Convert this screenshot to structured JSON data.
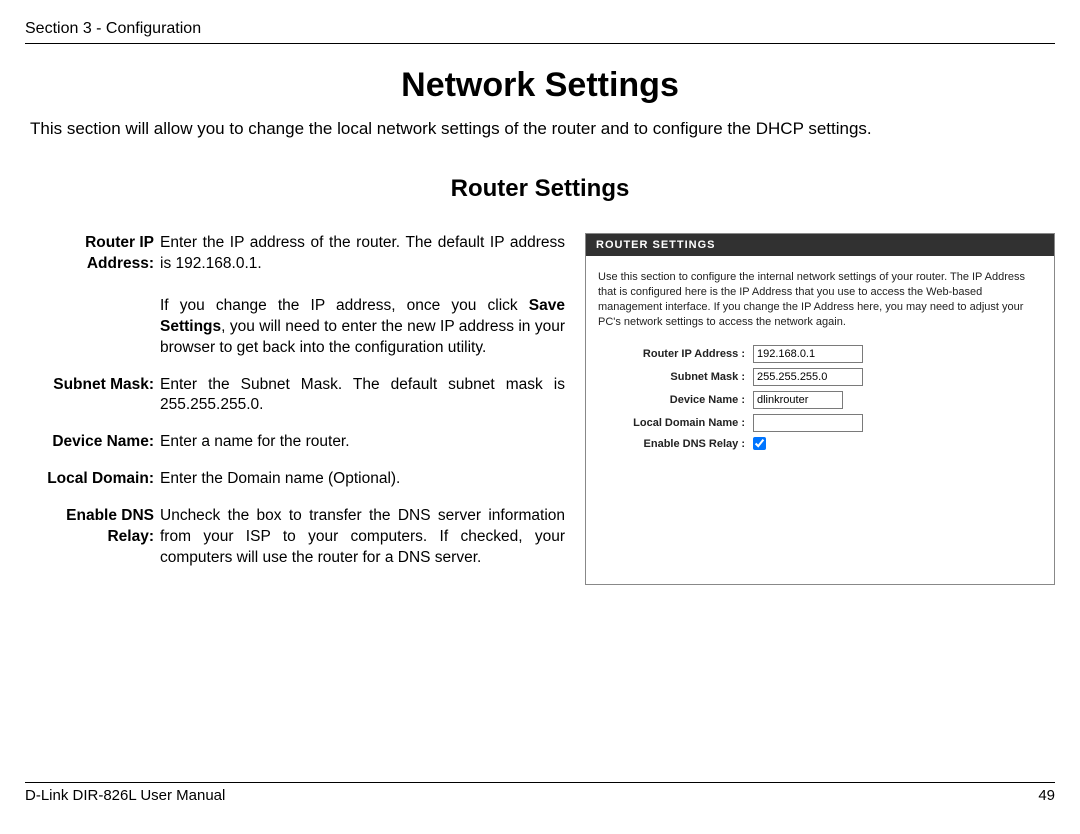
{
  "header": {
    "section_label": "Section 3 - Configuration"
  },
  "title": "Network Settings",
  "intro": "This section will allow you to change the local network settings of the router and to configure the DHCP settings.",
  "subtitle": "Router Settings",
  "definitions": {
    "router_ip": {
      "term": "Router IP Address:",
      "desc1": "Enter the IP address of the router. The default IP address is 192.168.0.1.",
      "desc2a": "If you change the IP address, once you click ",
      "desc2bold": "Save Settings",
      "desc2b": ", you will need to enter the new IP address in your browser to get back into the configuration utility."
    },
    "subnet": {
      "term": "Subnet Mask:",
      "desc": "Enter the Subnet Mask. The default subnet mask is 255.255.255.0."
    },
    "device_name": {
      "term": "Device Name:",
      "desc": "Enter a name for the router."
    },
    "local_domain": {
      "term": "Local Domain:",
      "desc": "Enter the Domain name (Optional)."
    },
    "dns_relay": {
      "term": "Enable DNS Relay:",
      "desc": "Uncheck the box to transfer the DNS server information from your ISP to your computers. If checked, your computers will use the router for a DNS server."
    }
  },
  "panel": {
    "header": "ROUTER SETTINGS",
    "desc": "Use this section to configure the internal network settings of your router. The IP Address that is configured here is the IP Address that you use to access the Web-based management interface. If you change the IP Address here, you may need to adjust your PC's network settings to access the network again.",
    "fields": {
      "router_ip": {
        "label": "Router IP Address :",
        "value": "192.168.0.1"
      },
      "subnet": {
        "label": "Subnet Mask :",
        "value": "255.255.255.0"
      },
      "device": {
        "label": "Device Name :",
        "value": "dlinkrouter"
      },
      "local_domain": {
        "label": "Local Domain Name :",
        "value": ""
      },
      "dns_relay": {
        "label": "Enable DNS Relay :",
        "checked": true
      }
    }
  },
  "footer": {
    "manual": "D-Link DIR-826L User Manual",
    "page": "49"
  }
}
